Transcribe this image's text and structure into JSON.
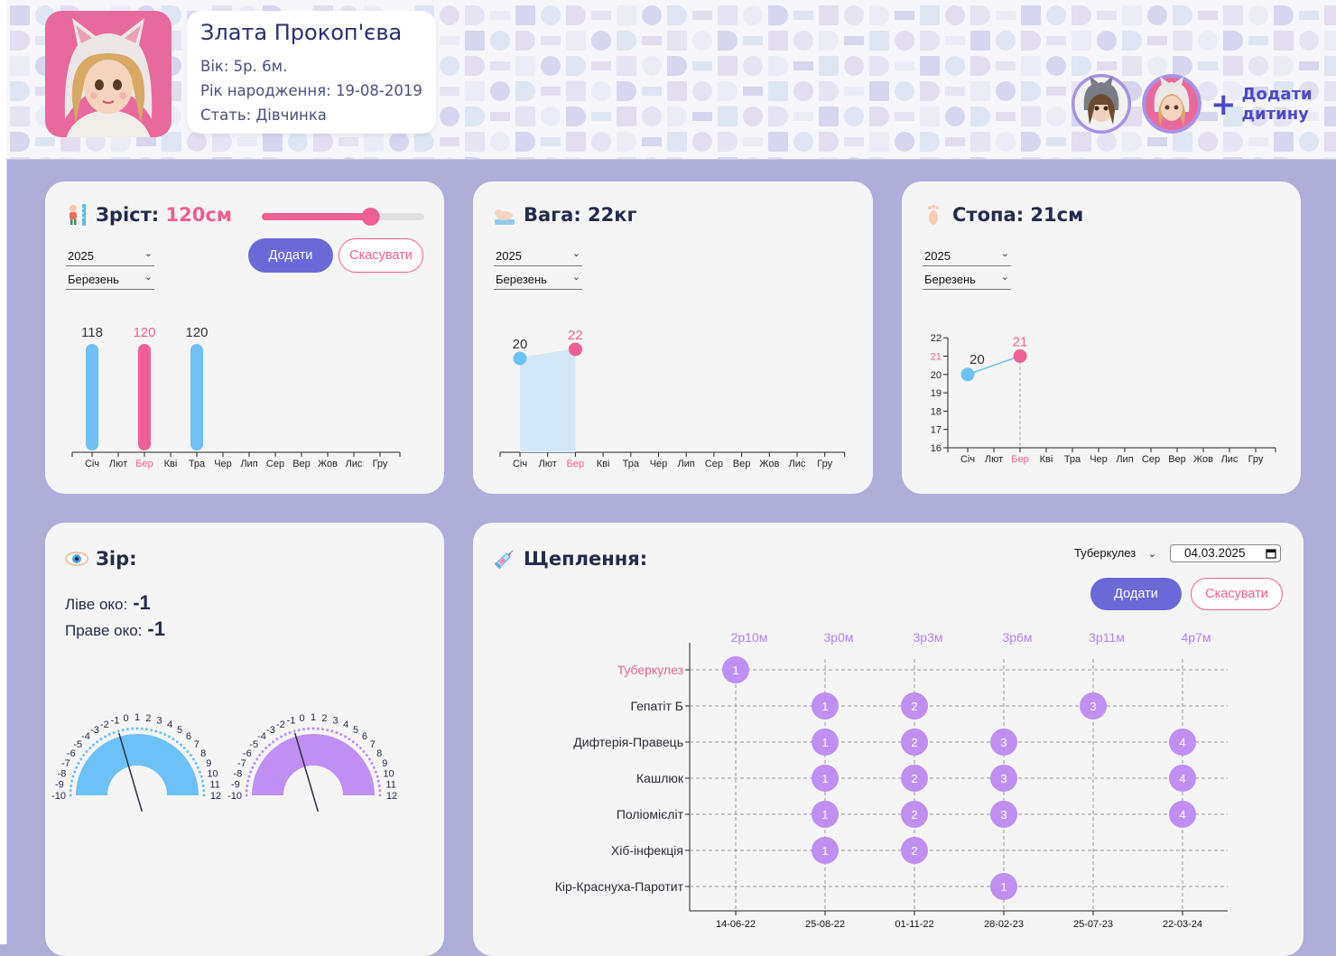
{
  "profile": {
    "name": "Злата Прокоп'єва",
    "age": "Вік: 5р. 6м.",
    "birth": "Рік народження: 19-08-2019",
    "sex": "Стать: Дівчинка"
  },
  "add_child": {
    "line1": "Додати",
    "line2": "дитину"
  },
  "months_short": [
    "Січ",
    "Лют",
    "Бер",
    "Кві",
    "Тра",
    "Чер",
    "Лип",
    "Сер",
    "Вер",
    "Жов",
    "Лис",
    "Гру"
  ],
  "colors": {
    "accent": "#ee5f95",
    "blue": "#6ec1f5",
    "purple": "#bf8ff2",
    "button": "#6b68d8",
    "background": "#aeaed9"
  },
  "height": {
    "label": "Зріст:",
    "value": "120см",
    "slider_fraction": 0.67,
    "year": "2025",
    "month": "Березень",
    "add_label": "Додати",
    "cancel_label": "Скасувати"
  },
  "weight": {
    "label": "Вага: 22кг",
    "year": "2025",
    "month": "Березень"
  },
  "foot": {
    "label": "Стопа: 21см",
    "year": "2025",
    "month": "Березень"
  },
  "vision": {
    "label": "Зір:",
    "left_label": "Ліве око:",
    "left_value": "-1",
    "right_label": "Праве око:",
    "right_value": "-1"
  },
  "vaccines": {
    "label": "Щеплення:",
    "selected": "Туберкулез",
    "date": "04.03.2025",
    "add_label": "Додати",
    "cancel_label": "Скасувати"
  },
  "chart_data": [
    {
      "type": "bar",
      "name": "height",
      "categories": [
        "Січ",
        "Лют",
        "Бер",
        "Кві",
        "Тра",
        "Чер",
        "Лип",
        "Сер",
        "Вер",
        "Жов",
        "Лис",
        "Гру"
      ],
      "points": [
        {
          "month_index": 0,
          "value": 118,
          "highlight": false
        },
        {
          "month_index": 2,
          "value": 120,
          "highlight": true
        },
        {
          "month_index": 4,
          "value": 120,
          "highlight": false
        }
      ],
      "highlight_category": "Бер"
    },
    {
      "type": "area",
      "name": "weight",
      "categories": [
        "Січ",
        "Лют",
        "Бер",
        "Кві",
        "Тра",
        "Чер",
        "Лип",
        "Сер",
        "Вер",
        "Жов",
        "Лис",
        "Гру"
      ],
      "points": [
        {
          "month_index": 0,
          "value": 20,
          "highlight": false
        },
        {
          "month_index": 2,
          "value": 22,
          "highlight": true
        }
      ],
      "highlight_category": "Бер"
    },
    {
      "type": "line",
      "name": "foot",
      "categories": [
        "Січ",
        "Лют",
        "Бер",
        "Кві",
        "Тра",
        "Чер",
        "Лип",
        "Сер",
        "Вер",
        "Жов",
        "Лис",
        "Гру"
      ],
      "y_ticks": [
        16,
        17,
        18,
        19,
        20,
        21,
        22
      ],
      "ylim": [
        16,
        22
      ],
      "points": [
        {
          "month_index": 0,
          "value": 20,
          "highlight": false
        },
        {
          "month_index": 2,
          "value": 21,
          "highlight": true
        }
      ],
      "highlight_category": "Бер"
    },
    {
      "type": "gauge",
      "name": "vision",
      "ticks": [
        "-10",
        "-9",
        "-8",
        "-7",
        "-6",
        "-5",
        "-4",
        "-3",
        "-2",
        "-1",
        "0",
        "1",
        "2",
        "3",
        "4",
        "5",
        "6",
        "7",
        "8",
        "9",
        "10",
        "11",
        "12"
      ],
      "range": [
        -10,
        12
      ],
      "gauges": [
        {
          "eye": "left",
          "value": -1,
          "color": "#6ec1f5"
        },
        {
          "eye": "right",
          "value": -1,
          "color": "#bf8ff2"
        }
      ]
    },
    {
      "type": "scatter",
      "name": "vaccinations",
      "categories": [
        "Туберкулез",
        "Гепатіт Б",
        "Дифтерія-Правець",
        "Кашлюк",
        "Поліомієліт",
        "Хіб-інфекція",
        "Кір-Краснуха-Паротит"
      ],
      "highlight_category": "Туберкулез",
      "x_ticks": [
        "14-06-22",
        "25-08-22",
        "01-11-22",
        "28-02-23",
        "25-07-23",
        "22-03-24"
      ],
      "age_labels": [
        "2р10м",
        "3р0м",
        "3р3м",
        "3р6м",
        "3р11м",
        "4р7м"
      ],
      "points": [
        {
          "category": "Туберкулез",
          "date": "14-06-22",
          "dose": "1"
        },
        {
          "category": "Гепатіт Б",
          "date": "25-08-22",
          "dose": "1"
        },
        {
          "category": "Гепатіт Б",
          "date": "01-11-22",
          "dose": "2"
        },
        {
          "category": "Гепатіт Б",
          "date": "25-07-23",
          "dose": "3"
        },
        {
          "category": "Дифтерія-Правець",
          "date": "25-08-22",
          "dose": "1"
        },
        {
          "category": "Дифтерія-Правець",
          "date": "01-11-22",
          "dose": "2"
        },
        {
          "category": "Дифтерія-Правець",
          "date": "28-02-23",
          "dose": "3"
        },
        {
          "category": "Дифтерія-Правець",
          "date": "22-03-24",
          "dose": "4"
        },
        {
          "category": "Кашлюк",
          "date": "25-08-22",
          "dose": "1"
        },
        {
          "category": "Кашлюк",
          "date": "01-11-22",
          "dose": "2"
        },
        {
          "category": "Кашлюк",
          "date": "28-02-23",
          "dose": "3"
        },
        {
          "category": "Кашлюк",
          "date": "22-03-24",
          "dose": "4"
        },
        {
          "category": "Поліомієліт",
          "date": "25-08-22",
          "dose": "1"
        },
        {
          "category": "Поліомієліт",
          "date": "01-11-22",
          "dose": "2"
        },
        {
          "category": "Поліомієліт",
          "date": "28-02-23",
          "dose": "3"
        },
        {
          "category": "Поліомієліт",
          "date": "22-03-24",
          "dose": "4"
        },
        {
          "category": "Хіб-інфекція",
          "date": "25-08-22",
          "dose": "1"
        },
        {
          "category": "Хіб-інфекція",
          "date": "01-11-22",
          "dose": "2"
        },
        {
          "category": "Кір-Краснуха-Паротит",
          "date": "28-02-23",
          "dose": "1"
        }
      ]
    }
  ]
}
